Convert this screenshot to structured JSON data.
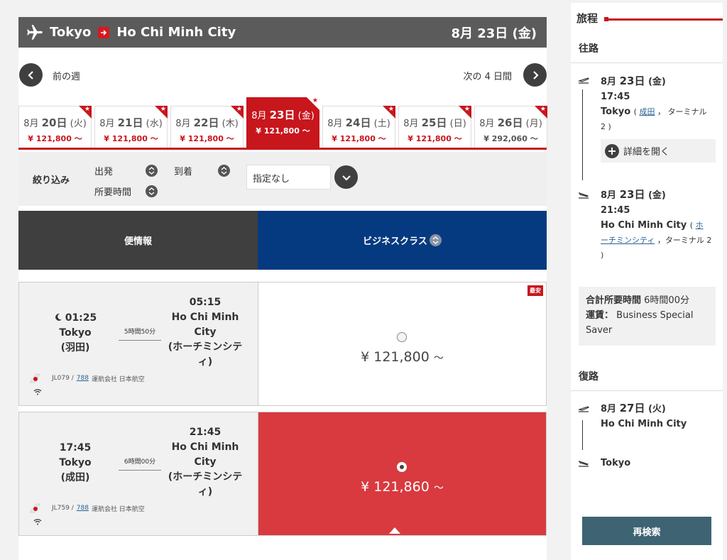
{
  "header": {
    "origin": "Tokyo",
    "destination": "Ho Chi Minh City",
    "date": "8月 23日 (金)"
  },
  "week_nav": {
    "prev_label": "前の週",
    "next_label": "次の 4 日間"
  },
  "date_tabs": [
    {
      "month": "8月",
      "day": "20日",
      "weekday": "(火)",
      "price": "¥ 121,800 ～",
      "selected": false
    },
    {
      "month": "8月",
      "day": "21日",
      "weekday": "(水)",
      "price": "¥ 121,800 ～",
      "selected": false
    },
    {
      "month": "8月",
      "day": "22日",
      "weekday": "(木)",
      "price": "¥ 121,800 ～",
      "selected": false
    },
    {
      "month": "8月",
      "day": "23日",
      "weekday": "(金)",
      "price": "¥ 121,800 ～",
      "selected": true
    },
    {
      "month": "8月",
      "day": "24日",
      "weekday": "(土)",
      "price": "¥ 121,800 ～",
      "selected": false
    },
    {
      "month": "8月",
      "day": "25日",
      "weekday": "(日)",
      "price": "¥ 121,800 ～",
      "selected": false
    },
    {
      "month": "8月",
      "day": "26日",
      "weekday": "(月)",
      "price": "¥ 292,060 ～",
      "selected": false
    }
  ],
  "filters": {
    "title": "絞り込み",
    "departure": "出発",
    "arrival": "到着",
    "duration": "所要時間",
    "select_value": "指定なし"
  },
  "columns": {
    "flight_info": "便情報",
    "cabin_class": "ビジネスクラス"
  },
  "flights": [
    {
      "dep_time": "01:25",
      "dep_city": "Tokyo",
      "dep_airport": "(羽田)",
      "duration": "5時間50分",
      "arr_time": "05:15",
      "arr_city_1": "Ho Chi Minh",
      "arr_city_2": "City",
      "arr_airport_1": "(ホーチミンシテ",
      "arr_airport_2": "ィ)",
      "flight_no": "JL079 /",
      "aircraft": "788",
      "operator": "運航会社 日本航空",
      "price": "¥ 121,800",
      "price_suffix": "～",
      "badge": "最安",
      "selected": false
    },
    {
      "dep_time": "17:45",
      "dep_city": "Tokyo",
      "dep_airport": "(成田)",
      "duration": "6時間00分",
      "arr_time": "21:45",
      "arr_city_1": "Ho Chi Minh",
      "arr_city_2": "City",
      "arr_airport_1": "(ホーチミンシテ",
      "arr_airport_2": "ィ)",
      "flight_no": "JL759 /",
      "aircraft": "788",
      "operator": "運航会社 日本航空",
      "price": "¥ 121,860",
      "price_suffix": "～",
      "selected": true
    }
  ],
  "itinerary": {
    "title": "旅程",
    "outbound_label": "往路",
    "outbound": {
      "dep_date_month": "8月",
      "dep_date_day": "23日",
      "dep_date_wd": "(金)",
      "dep_time": "17:45",
      "dep_city": "Tokyo",
      "dep_airport_link": "成田",
      "dep_terminal_1": "， ターミナル",
      "dep_terminal_2": "2 )",
      "detail_button": "詳細を開く",
      "arr_date_month": "8月",
      "arr_date_day": "23日",
      "arr_date_wd": "(金)",
      "arr_time": "21:45",
      "arr_city": "Ho Chi Minh City",
      "arr_airport_link_1": "ホ",
      "arr_airport_link_2": "ーチミンシティ",
      "arr_terminal": "，ターミナル 2",
      "arr_close": ")"
    },
    "summary": {
      "total_label": "合計所要時間",
      "total_value": "6時間00分",
      "fare_label": "運賃：",
      "fare_value_1": "Business Special",
      "fare_value_2": "Saver"
    },
    "return_label": "復路",
    "return": {
      "date_month": "8月",
      "date_day": "27日",
      "date_wd": "(火)",
      "from_city": "Ho Chi Minh City",
      "to_city": "Tokyo"
    },
    "search_button": "再検索"
  },
  "colors": {
    "brand_red": "#c8161d",
    "selected_fare": "#d83a3f",
    "class_header": "#053a80",
    "dark_gray": "#3f3f3f",
    "search_button": "#3e6373"
  },
  "icons": [
    "airplane-icon",
    "arrow-right-icon",
    "chevron-left-icon",
    "chevron-right-icon",
    "sort-icon",
    "chevron-down-icon",
    "moon-icon",
    "wifi-icon",
    "takeoff-icon",
    "landing-icon",
    "plus-icon",
    "star-icon"
  ]
}
